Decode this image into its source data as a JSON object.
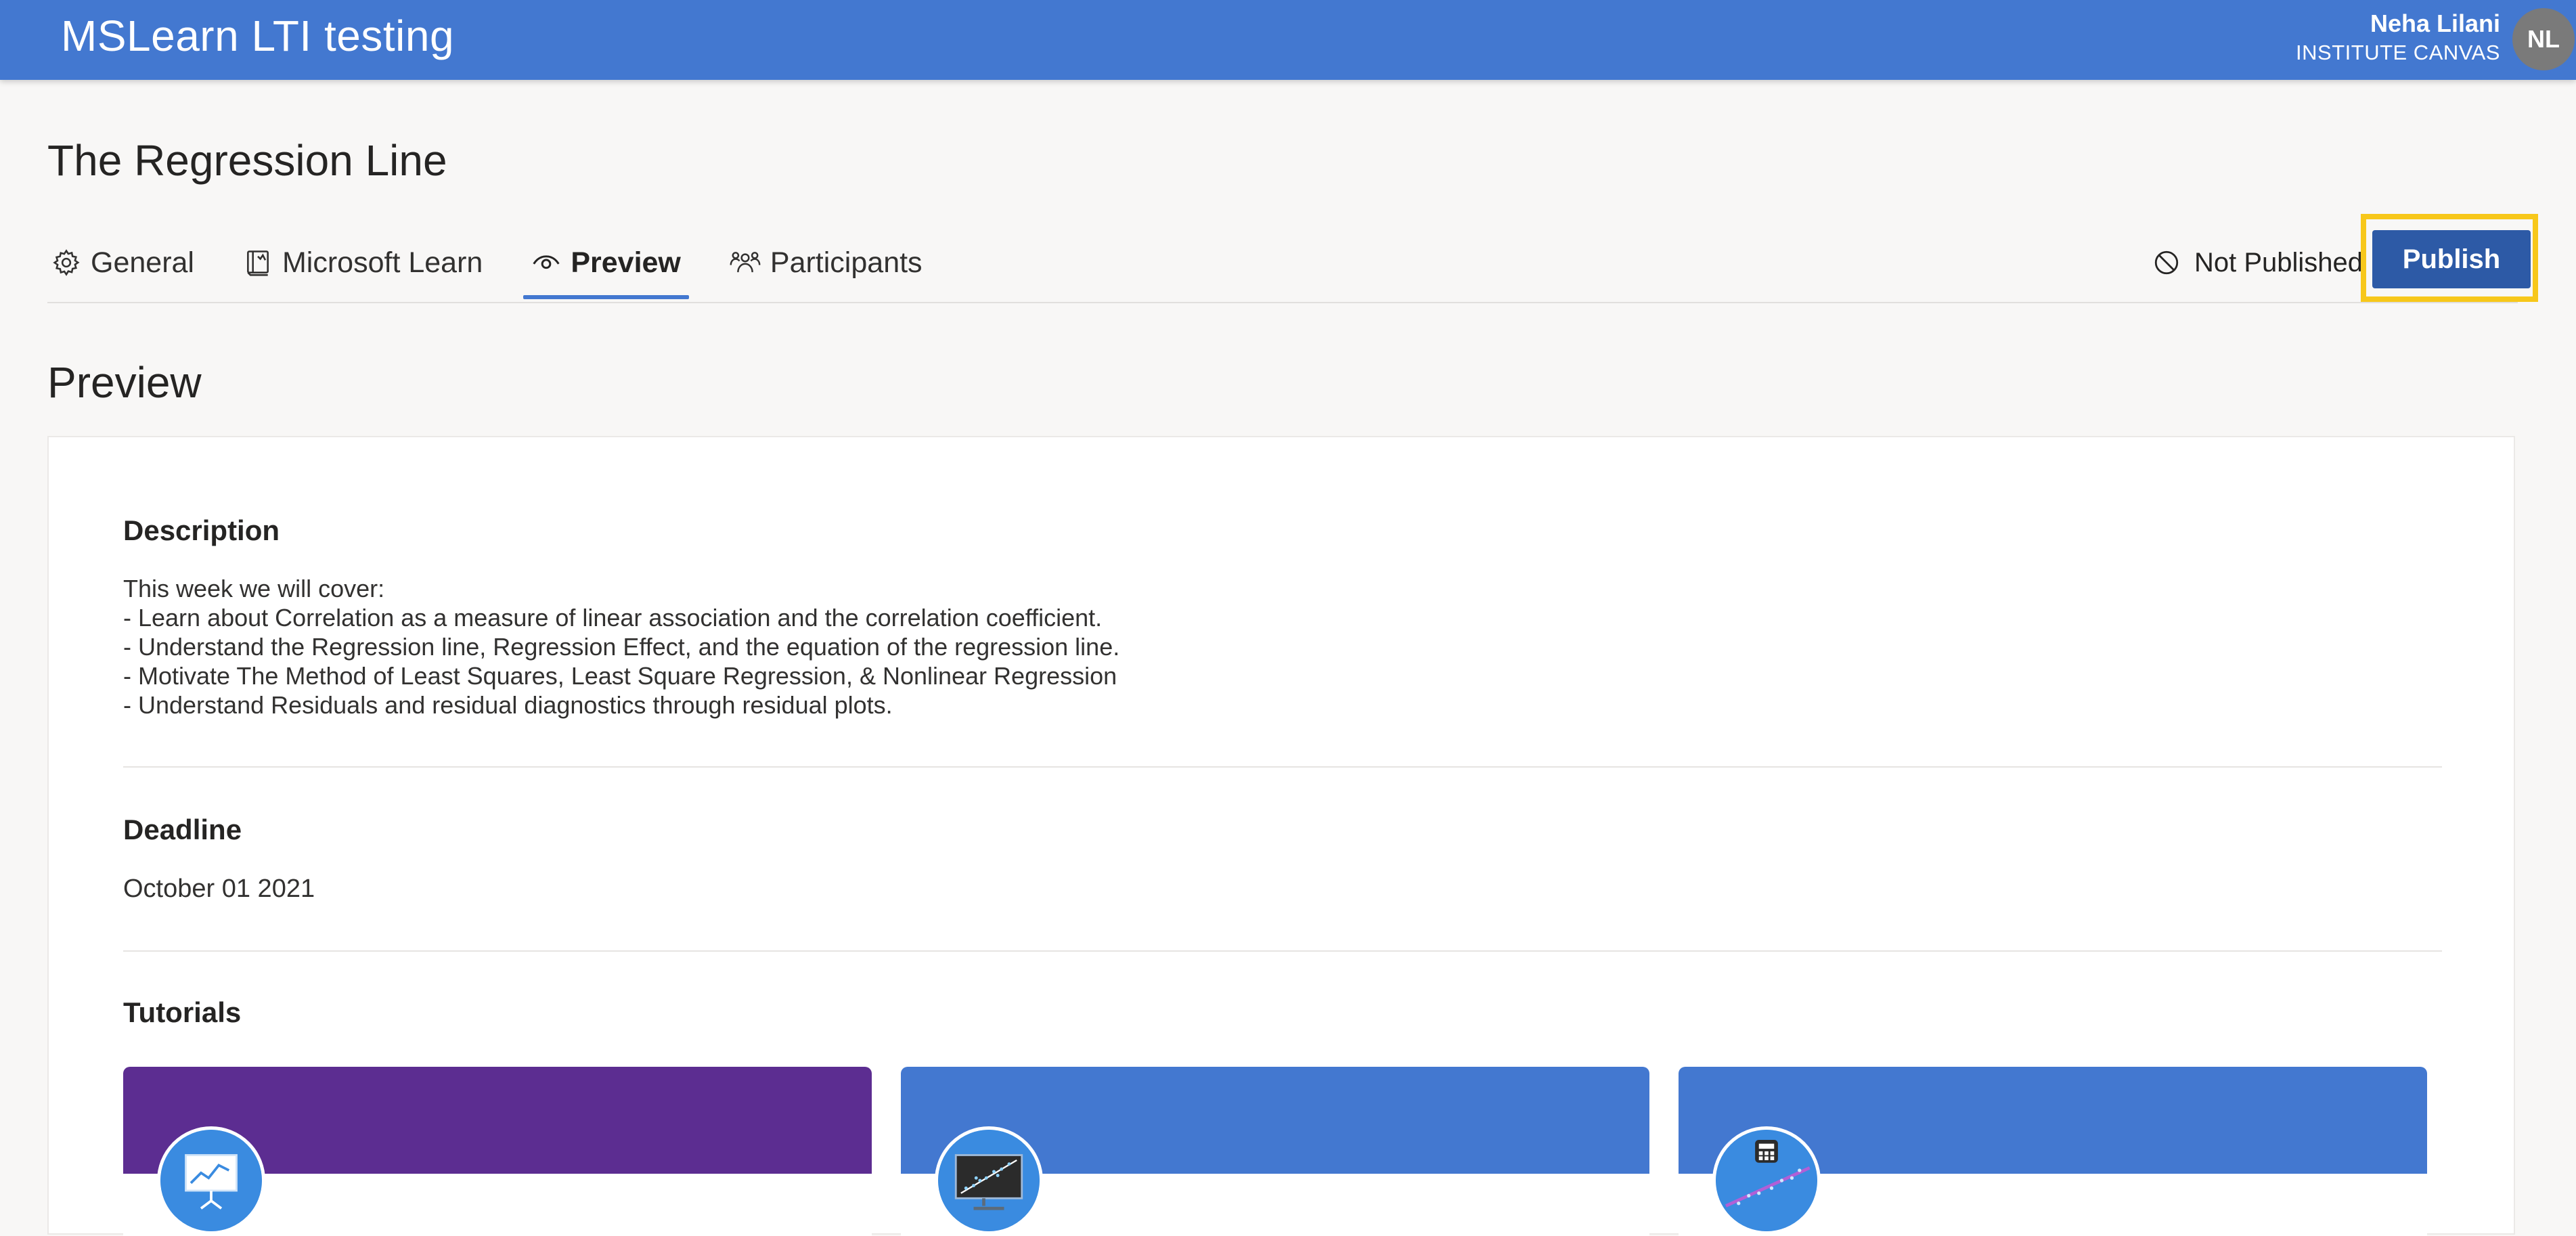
{
  "header": {
    "app_title": "MSLearn LTI testing",
    "user_name": "Neha Lilani",
    "user_org": "INSTITUTE CANVAS",
    "avatar_initials": "NL"
  },
  "page": {
    "title": "The Regression Line"
  },
  "tabs": [
    {
      "label": "General",
      "icon": "gear-icon",
      "active": false
    },
    {
      "label": "Microsoft Learn",
      "icon": "map-book-icon",
      "active": false
    },
    {
      "label": "Preview",
      "icon": "eye-icon",
      "active": true
    },
    {
      "label": "Participants",
      "icon": "people-icon",
      "active": false
    }
  ],
  "status": {
    "label": "Not Published",
    "icon": "blocked-icon",
    "publish_label": "Publish"
  },
  "preview": {
    "section_title": "Preview",
    "description_heading": "Description",
    "description_lines": [
      "This week we will cover:",
      "- Learn about Correlation as a measure of linear association and the correlation coefficient.",
      "- Understand the Regression line, Regression Effect, and the equation of the regression line.",
      "- Motivate The Method of Least Squares, Least Square Regression, & Nonlinear Regression",
      "- Understand Residuals and residual diagnostics through residual plots."
    ],
    "deadline_heading": "Deadline",
    "deadline_value": "October 01 2021",
    "tutorials_heading": "Tutorials",
    "tutorials": [
      {
        "banner_color": "#5c2d91",
        "icon": "presentation-chart-icon"
      },
      {
        "banner_color": "#4378d0",
        "icon": "monitor-scatter-icon"
      },
      {
        "banner_color": "#4378d0",
        "icon": "calculator-regression-icon"
      }
    ]
  },
  "colors": {
    "header_blue": "#4378d0",
    "publish_button": "#2d5aa6",
    "highlight_frame": "#f7c71a",
    "active_tab_underline": "#4378d0"
  }
}
